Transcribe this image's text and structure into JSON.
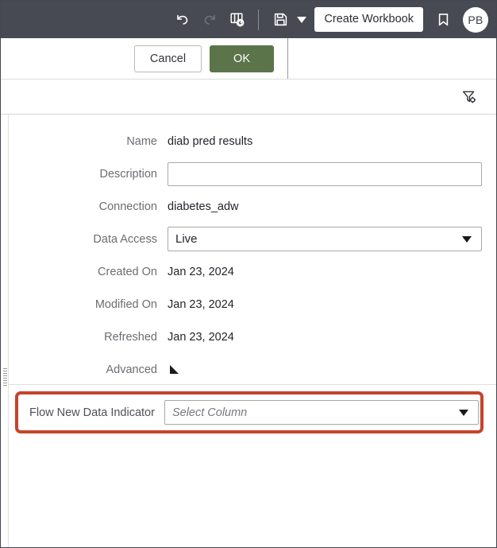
{
  "toolbar": {
    "undo_icon": "undo-icon",
    "redo_icon": "redo-icon",
    "refresh_data_icon": "refresh-dataset-icon",
    "save_icon": "save-icon",
    "save_caret_icon": "chevron-down-icon",
    "create_workbook_label": "Create Workbook",
    "bookmark_icon": "bookmark-icon",
    "avatar_initials": "PB",
    "background_color": "#474a52"
  },
  "actions": {
    "cancel_label": "Cancel",
    "ok_label": "OK",
    "ok_color": "#5b7449"
  },
  "filter_bar": {
    "filter_icon": "filter-settings-icon"
  },
  "form": {
    "rows": [
      {
        "label": "Name",
        "value": "diab pred results"
      },
      {
        "label": "Description",
        "value": ""
      },
      {
        "label": "Connection",
        "value": "diabetes_adw"
      },
      {
        "label": "Data Access",
        "value": "Live"
      },
      {
        "label": "Created On",
        "value": "Jan 23, 2024"
      },
      {
        "label": "Modified On",
        "value": "Jan 23, 2024"
      },
      {
        "label": "Refreshed",
        "value": "Jan 23, 2024"
      },
      {
        "label": "Advanced",
        "value": ""
      }
    ],
    "description_placeholder": "",
    "data_access_selected": "Live",
    "advanced_toggle_icon": "triangle-right-icon"
  },
  "flow_row": {
    "label": "Flow New Data Indicator",
    "placeholder": "Select Column",
    "caret_icon": "chevron-down-icon",
    "highlight_color": "#c6432c"
  },
  "grip": {
    "name": "resize-grip-handle"
  }
}
